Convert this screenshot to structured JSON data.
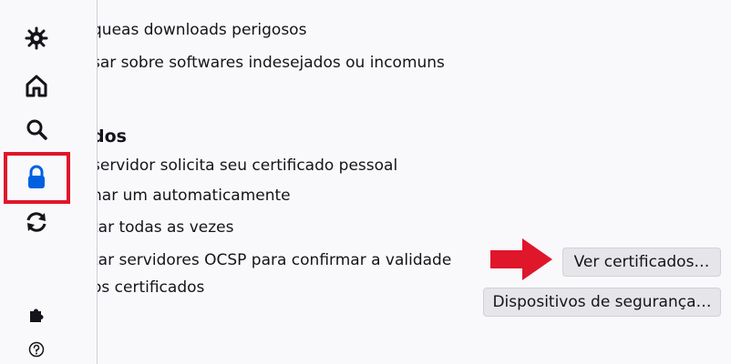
{
  "sidebar": {
    "items": [
      {
        "icon": "gear-icon"
      },
      {
        "icon": "home-icon"
      },
      {
        "icon": "search-icon"
      },
      {
        "icon": "lock-icon",
        "selected": true
      },
      {
        "icon": "sync-icon"
      },
      {
        "icon": "puzzle-icon"
      },
      {
        "icon": "help-icon"
      }
    ]
  },
  "content": {
    "block_downloads": "queas downloads perigosos",
    "warn_software": "sar sobre softwares indesejados ou incomuns",
    "certificates_heading": "dos",
    "server_requests": "servidor solicita seu certificado pessoal",
    "select_auto": "nar um automaticamente",
    "ask_every_time": "tar todas as vezes",
    "ocsp": "tar servidores OCSP para confirmar a validade",
    "of_certificates": "os certificados",
    "view_certificates_button": "Ver certificados…",
    "security_devices_button": "Dispositivos de segurança…"
  },
  "colors": {
    "accent": "#0061e0",
    "annotation": "#e0162b"
  }
}
